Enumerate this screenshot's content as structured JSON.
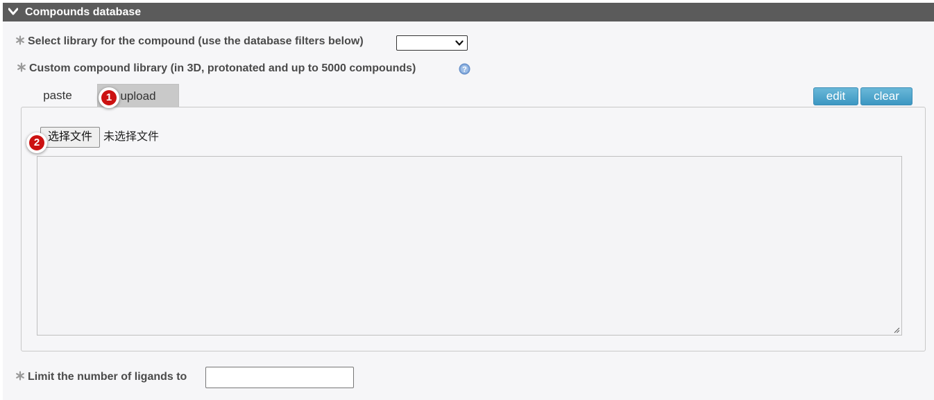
{
  "header": {
    "title": "Compounds database",
    "toggle_icon": "chevron-down-icon"
  },
  "library_select": {
    "label": "Select library for the compound (use the database filters below)",
    "value": ""
  },
  "custom_library": {
    "label": "Custom compound library (in 3D, protonated and up to 5000 compounds)",
    "help_icon": "help-icon"
  },
  "tabs": [
    {
      "label": "paste",
      "active": false
    },
    {
      "label": "upload",
      "active": true
    }
  ],
  "actions": {
    "edit_label": "edit",
    "clear_label": "clear"
  },
  "upload": {
    "choose_file_label": "选择文件",
    "no_file_text": "未选择文件",
    "content_value": ""
  },
  "markers": {
    "one": "1",
    "two": "2"
  },
  "limit": {
    "label": "Limit the number of ligands to",
    "value": ""
  },
  "colors": {
    "header_bg": "#5b5b5b",
    "accent_blue": "#3c97c2",
    "marker_red": "#cc1111",
    "panel_bg": "#f6f6f8"
  }
}
